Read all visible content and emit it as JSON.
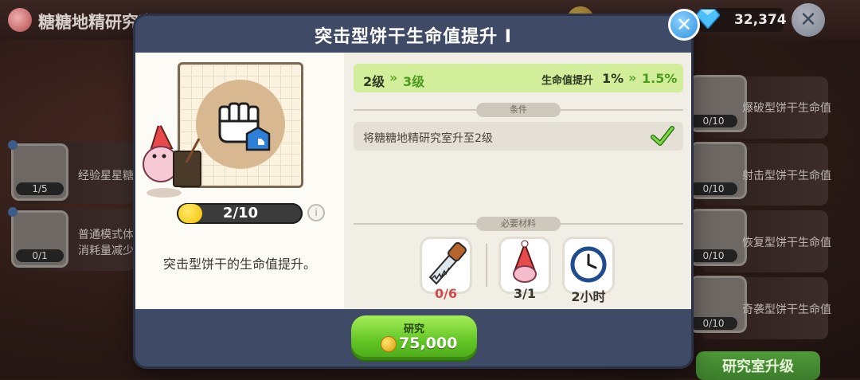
{
  "background": {
    "title": "糖糖地精研究室",
    "gem_count": "32,374",
    "left_cards": [
      {
        "text": "经验星星糖",
        "progress": "1/5"
      },
      {
        "text": "普通模式体",
        "text2": "消耗量减少",
        "progress": "0/1"
      }
    ],
    "right_cards": [
      {
        "text": "爆破型饼干生命值",
        "progress": "0/10"
      },
      {
        "text": "射击型饼干生命值",
        "progress": "0/10"
      },
      {
        "text": "恢复型饼干生命值",
        "progress": "0/10"
      },
      {
        "text": "奇袭型饼干生命值",
        "progress": "0/10"
      }
    ],
    "upgrade_button": "研究室升级"
  },
  "modal": {
    "title": "突击型饼干生命值提升 I",
    "close_symbol": "✕",
    "level_progress": "2/10",
    "level_fraction": 0.2,
    "description": "突击型饼干的生命值提升。",
    "info_symbol": "i",
    "upgrade": {
      "from_level": "2级",
      "to_level": "3级",
      "stat_label": "生命值提升",
      "from_value": "1%",
      "to_value": "1.5%",
      "arrow": "»"
    },
    "conditions_label": "条件",
    "condition_text": "将糖糖地精研究室升至2级",
    "materials_label": "必要材料",
    "materials": [
      {
        "icon": "saw-icon",
        "count": "0/6",
        "color": "#d24b4b"
      },
      {
        "icon": "gnome-hat-icon",
        "count": "3/1",
        "color": "#3a352f"
      },
      {
        "icon": "clock-icon",
        "count": "2小时",
        "color": "#3a352f"
      }
    ],
    "research_button": {
      "label": "研究",
      "cost": "75,000"
    }
  },
  "colors": {
    "modal_frame": "#3f4b66",
    "upgrade_row": "#d3ee9a",
    "accent_green": "#5fa62a",
    "insufficient": "#d24b4b"
  }
}
